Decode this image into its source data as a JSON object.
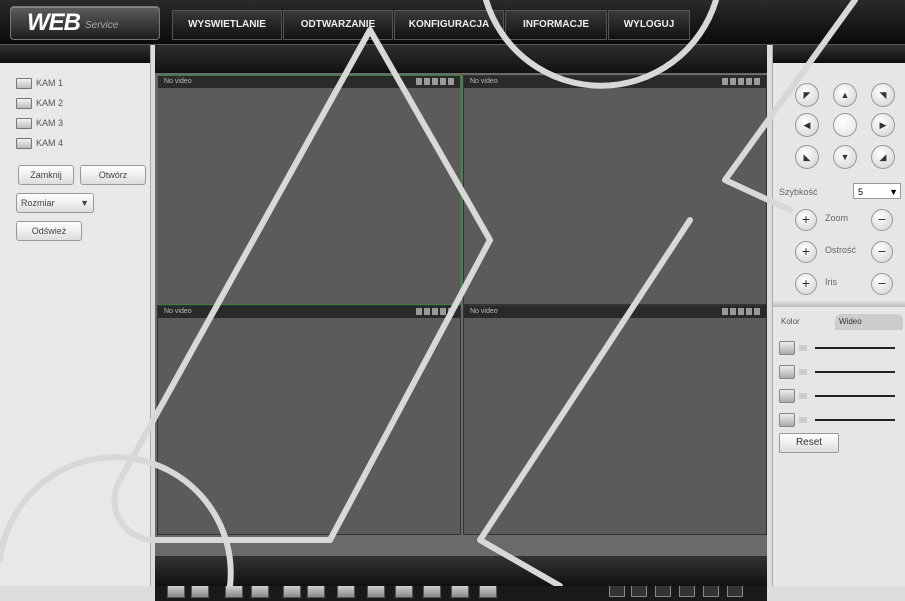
{
  "header": {
    "logo_main": "WEB",
    "logo_sub": "Service",
    "nav": [
      {
        "label": "WYSWIETLANIE"
      },
      {
        "label": "ODTWARZANIE"
      },
      {
        "label": "KONFIGURACJA"
      },
      {
        "label": "INFORMACJE"
      },
      {
        "label": "WYLOGUJ"
      }
    ]
  },
  "left": {
    "cameras": [
      {
        "label": "KAM 1"
      },
      {
        "label": "KAM 2"
      },
      {
        "label": "KAM 3"
      },
      {
        "label": "KAM 4"
      }
    ],
    "btn_close_all": "Zamknij",
    "btn_open_all": "Otwórz",
    "select_value": "Rozmiar",
    "refresh_label": "Odśwież"
  },
  "main": {
    "cells": [
      {
        "title": "No video"
      },
      {
        "title": "No video"
      },
      {
        "title": "No video"
      },
      {
        "title": "No video"
      }
    ]
  },
  "right": {
    "dirs": [
      "◤",
      "▲",
      "◥",
      "◀",
      "",
      "▶",
      "◣",
      "▼",
      "◢"
    ],
    "speed_label": "Szybkość",
    "speed_value": "5",
    "zoom_label": "Zoom",
    "focus_label": "Ostrość",
    "iris_label": "Iris",
    "tab1": "Kolor",
    "tab2": "Wideo",
    "reset_label": "Reset"
  }
}
